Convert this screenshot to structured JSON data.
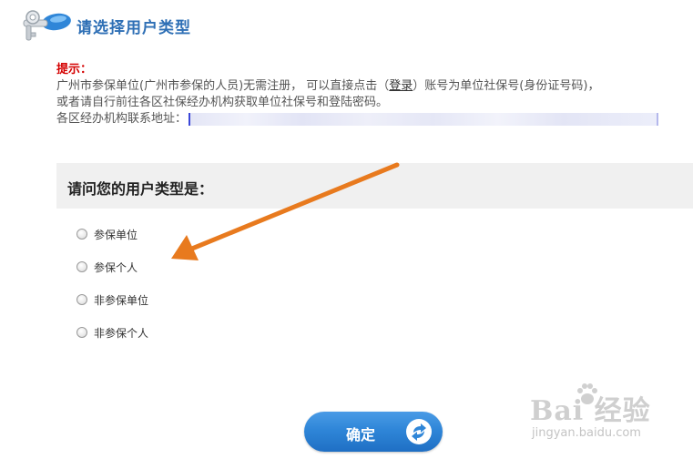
{
  "header": {
    "title": "请选择用户类型",
    "icon": "key-icon"
  },
  "notice": {
    "label": "提示：",
    "line1_pre": "广州市参保单位(广州市参保的人员)无需注册，  可以直接点击（",
    "line1_link": "登录",
    "line1_post": "）账号为单位社保号(身份证号码)，",
    "line2": "或者请自行前往各区社保经办机构获取单位社保号和登陆密码。",
    "line3_label": "各区经办机构联系地址："
  },
  "question": {
    "title": "请问您的用户类型是："
  },
  "options": [
    {
      "label": "参保单位",
      "selected": false
    },
    {
      "label": "参保个人",
      "selected": false
    },
    {
      "label": "非参保单位",
      "selected": false
    },
    {
      "label": "非参保个人",
      "selected": false
    }
  ],
  "confirm": {
    "label": "确定",
    "icon": "arrow-right-icon"
  },
  "watermark": {
    "main": "Bai 经验",
    "sub": "jingyan.baidu.com"
  },
  "colors": {
    "title": "#2e6fb5",
    "hint": "#d40000",
    "annotation_arrow": "#e87a1e",
    "button": "#2f86d8"
  }
}
